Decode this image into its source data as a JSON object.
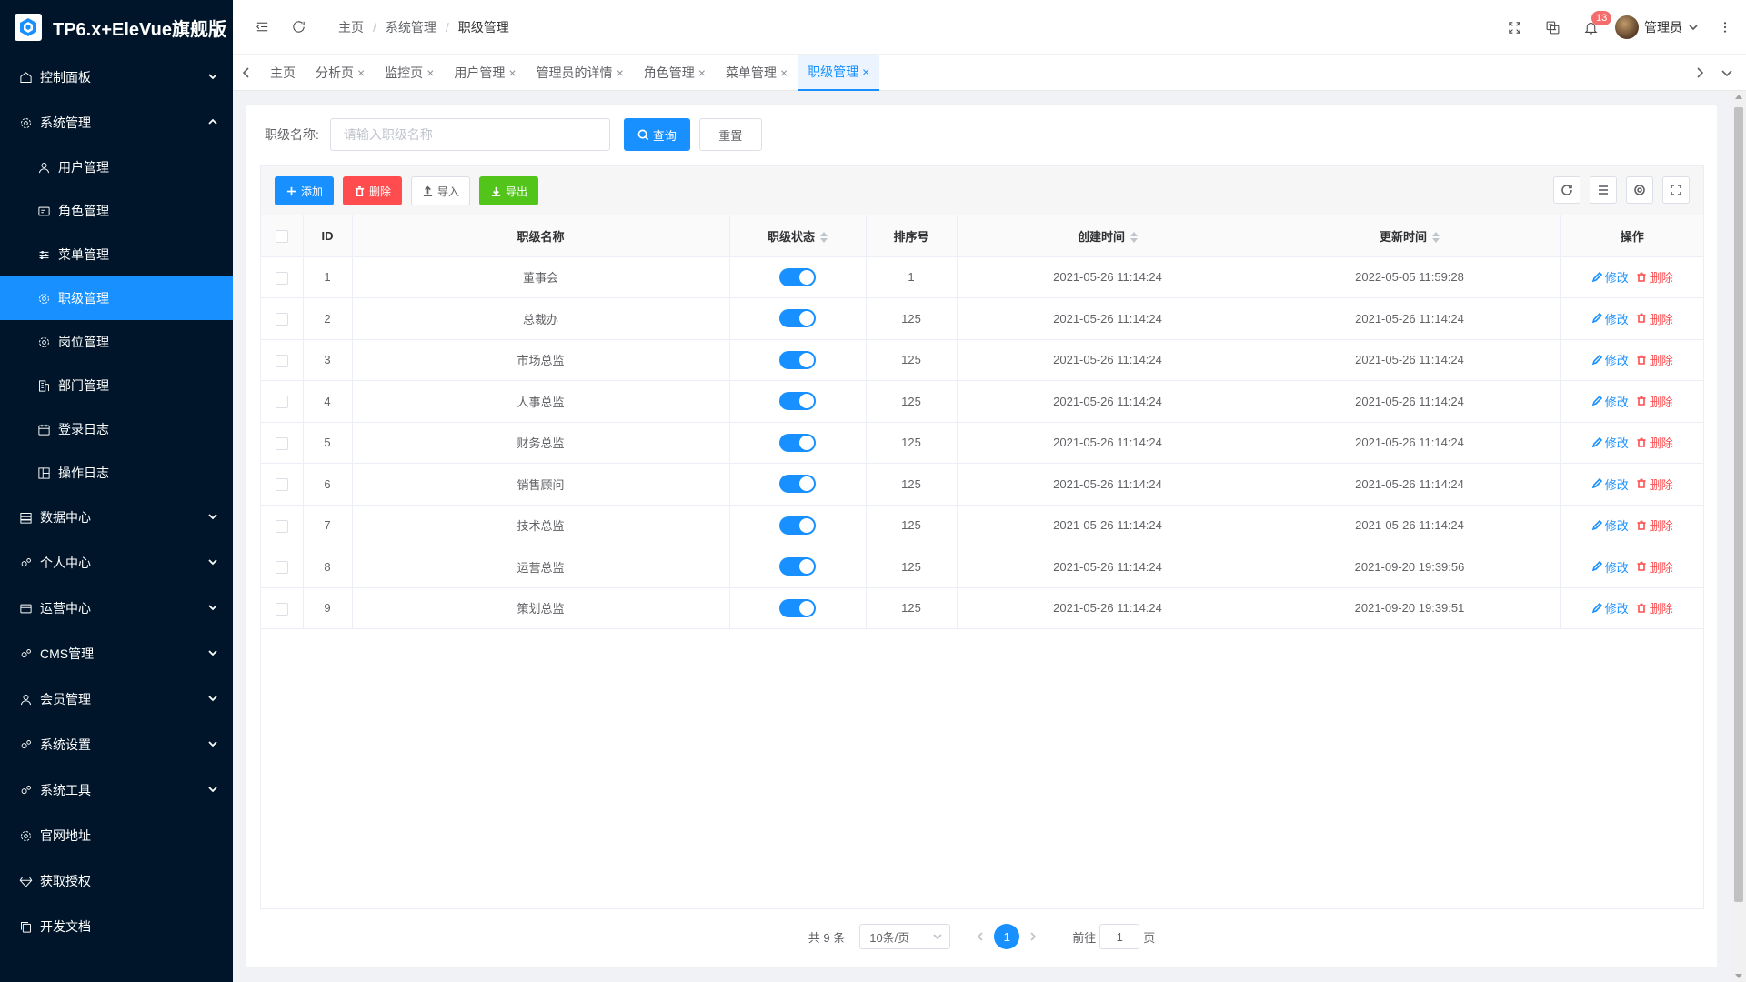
{
  "app": {
    "title": "TP6.x+EleVue旗舰版",
    "logo_icon": "hexagon-logo-icon"
  },
  "sidebar": {
    "items": [
      {
        "label": "控制面板",
        "icon": "home-icon",
        "expandable": true
      },
      {
        "label": "系统管理",
        "icon": "gear-icon",
        "expandable": true,
        "open": true,
        "children": [
          {
            "label": "用户管理",
            "icon": "user-icon"
          },
          {
            "label": "角色管理",
            "icon": "id-card-icon"
          },
          {
            "label": "菜单管理",
            "icon": "sliders-icon"
          },
          {
            "label": "职级管理",
            "icon": "gear-icon",
            "active": true
          },
          {
            "label": "岗位管理",
            "icon": "gear-icon"
          },
          {
            "label": "部门管理",
            "icon": "building-icon"
          },
          {
            "label": "登录日志",
            "icon": "calendar-icon"
          },
          {
            "label": "操作日志",
            "icon": "layout-icon"
          }
        ]
      },
      {
        "label": "数据中心",
        "icon": "database-icon",
        "expandable": true
      },
      {
        "label": "个人中心",
        "icon": "gears-icon",
        "expandable": true
      },
      {
        "label": "运营中心",
        "icon": "card-icon",
        "expandable": true
      },
      {
        "label": "CMS管理",
        "icon": "gears-icon",
        "expandable": true
      },
      {
        "label": "会员管理",
        "icon": "user-icon",
        "expandable": true
      },
      {
        "label": "系统设置",
        "icon": "gears-icon",
        "expandable": true
      },
      {
        "label": "系统工具",
        "icon": "gears-icon",
        "expandable": true
      },
      {
        "label": "官网地址",
        "icon": "gear-icon",
        "expandable": false
      },
      {
        "label": "获取授权",
        "icon": "diamond-icon",
        "expandable": false
      },
      {
        "label": "开发文档",
        "icon": "copy-icon",
        "expandable": false
      }
    ]
  },
  "header": {
    "breadcrumb": [
      "主页",
      "系统管理",
      "职级管理"
    ],
    "notification_count": "13",
    "user_name": "管理员"
  },
  "tabs": [
    {
      "label": "主页",
      "closable": false
    },
    {
      "label": "分析页",
      "closable": true
    },
    {
      "label": "监控页",
      "closable": true
    },
    {
      "label": "用户管理",
      "closable": true
    },
    {
      "label": "管理员的详情",
      "closable": true
    },
    {
      "label": "角色管理",
      "closable": true
    },
    {
      "label": "菜单管理",
      "closable": true
    },
    {
      "label": "职级管理",
      "closable": true,
      "active": true
    }
  ],
  "search": {
    "label": "职级名称:",
    "placeholder": "请输入职级名称",
    "query_label": "查询",
    "reset_label": "重置"
  },
  "toolbar": {
    "add_label": "添加",
    "delete_label": "删除",
    "import_label": "导入",
    "export_label": "导出"
  },
  "table": {
    "columns": [
      "ID",
      "职级名称",
      "职级状态",
      "排序号",
      "创建时间",
      "更新时间",
      "操作"
    ],
    "edit_label": "修改",
    "delete_label": "删除",
    "rows": [
      {
        "id": "1",
        "name": "董事会",
        "status": true,
        "sort": "1",
        "created": "2021-05-26 11:14:24",
        "updated": "2022-05-05 11:59:28"
      },
      {
        "id": "2",
        "name": "总裁办",
        "status": true,
        "sort": "125",
        "created": "2021-05-26 11:14:24",
        "updated": "2021-05-26 11:14:24"
      },
      {
        "id": "3",
        "name": "市场总监",
        "status": true,
        "sort": "125",
        "created": "2021-05-26 11:14:24",
        "updated": "2021-05-26 11:14:24"
      },
      {
        "id": "4",
        "name": "人事总监",
        "status": true,
        "sort": "125",
        "created": "2021-05-26 11:14:24",
        "updated": "2021-05-26 11:14:24"
      },
      {
        "id": "5",
        "name": "财务总监",
        "status": true,
        "sort": "125",
        "created": "2021-05-26 11:14:24",
        "updated": "2021-05-26 11:14:24"
      },
      {
        "id": "6",
        "name": "销售顾问",
        "status": true,
        "sort": "125",
        "created": "2021-05-26 11:14:24",
        "updated": "2021-05-26 11:14:24"
      },
      {
        "id": "7",
        "name": "技术总监",
        "status": true,
        "sort": "125",
        "created": "2021-05-26 11:14:24",
        "updated": "2021-05-26 11:14:24"
      },
      {
        "id": "8",
        "name": "运营总监",
        "status": true,
        "sort": "125",
        "created": "2021-05-26 11:14:24",
        "updated": "2021-09-20 19:39:56"
      },
      {
        "id": "9",
        "name": "策划总监",
        "status": true,
        "sort": "125",
        "created": "2021-05-26 11:14:24",
        "updated": "2021-09-20 19:39:51"
      }
    ]
  },
  "pagination": {
    "total_text": "共 9 条",
    "page_size": "10条/页",
    "current_page": "1",
    "goto_prefix": "前往",
    "goto_value": "1",
    "goto_suffix": "页"
  },
  "colors": {
    "primary": "#1890ff",
    "danger": "#ff4d4f",
    "success": "#52c41a",
    "sidebar_bg": "#001529"
  }
}
